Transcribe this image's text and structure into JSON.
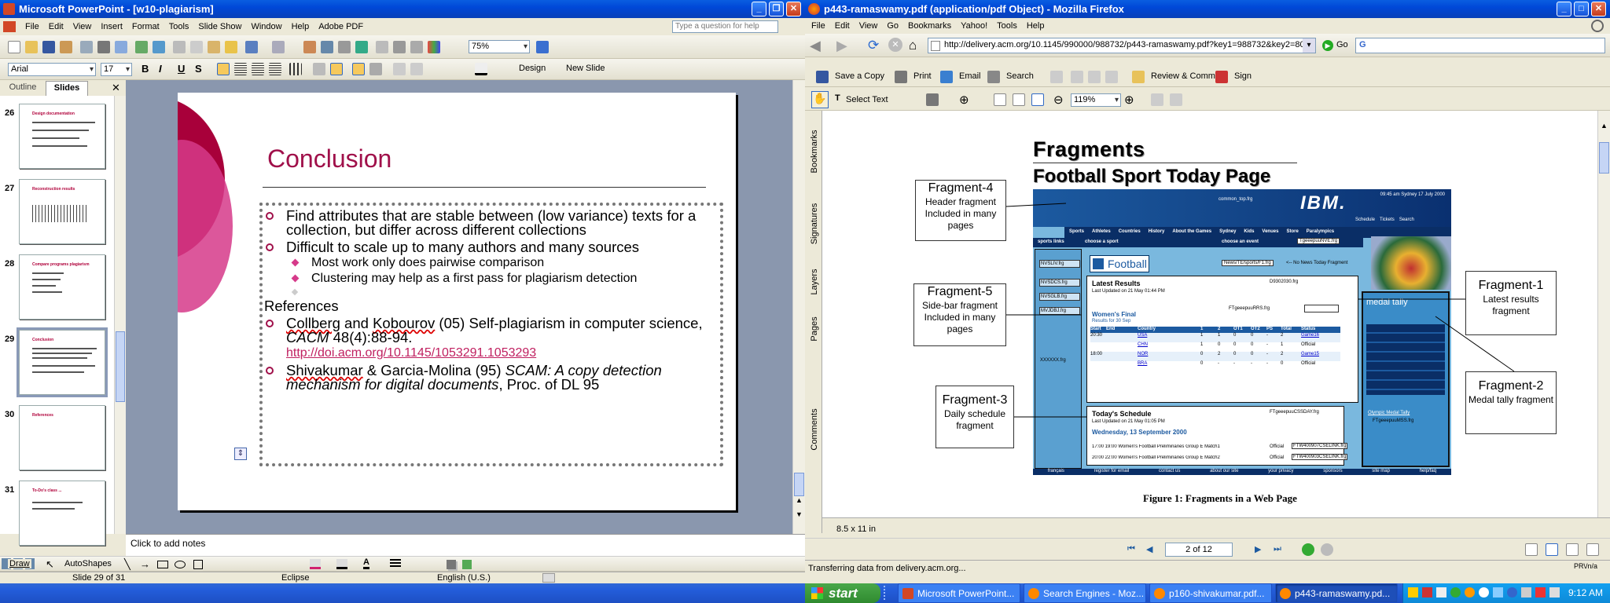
{
  "powerpoint": {
    "title": "Microsoft PowerPoint - [w10-plagiarism]",
    "menu": [
      "File",
      "Edit",
      "View",
      "Insert",
      "Format",
      "Tools",
      "Slide Show",
      "Window",
      "Help",
      "Adobe PDF"
    ],
    "help_placeholder": "Type a question for help",
    "zoom": "75%",
    "font": "Arial",
    "font_size": "17",
    "format_buttons": {
      "bold": "B",
      "italic": "I",
      "underline": "U",
      "shadow": "S"
    },
    "design_label": "Design",
    "new_slide_label": "New Slide",
    "tabs": [
      "Outline",
      "Slides"
    ],
    "thumbs": [
      {
        "num": "26",
        "title": "Design documentation"
      },
      {
        "num": "27",
        "title": "Reconstruction results"
      },
      {
        "num": "28",
        "title": "Compare programs plagiarism"
      },
      {
        "num": "29",
        "title": "Conclusion"
      },
      {
        "num": "30",
        "title": "References"
      },
      {
        "num": "31",
        "title": "To-Do's class ..."
      }
    ],
    "slide": {
      "title": "Conclusion",
      "b1": "Find attributes that are stable between (low variance) texts for a collection, but differ across different collections",
      "b2": "Difficult to scale up to many authors and many sources",
      "s1": "Most work only does pairwise comparison",
      "s2": "Clustering may help as a first pass for plagiarism detection",
      "refs": "References",
      "r1a": "Collberg",
      "r1b": " and ",
      "r1c": "Kobourov",
      "r1d": " (05) Self-plagiarism in computer science, ",
      "r1e": "CACM",
      "r1f": " 48(4):88-94.",
      "r1url": "http://doi.acm.org/10.1145/1053291.1053293",
      "r2a": "Shivakumar",
      "r2b": " & Garcia-Molina (95) ",
      "r2c": "SCAM: A copy detection mechanism for digital documents",
      "r2d": ", Proc. of DL 95"
    },
    "notes": "Click to add notes",
    "draw": "Draw",
    "autoshapes": "AutoShapes",
    "status": {
      "slide": "Slide 29 of 31",
      "theme": "Eclipse",
      "lang": "English (U.S.)"
    }
  },
  "firefox": {
    "title": "p443-ramaswamy.pdf (application/pdf Object) - Mozilla Firefox",
    "menu": [
      "File",
      "Edit",
      "View",
      "Go",
      "Bookmarks",
      "Yahoo!",
      "Tools",
      "Help"
    ],
    "url": "http://delivery.acm.org/10.1145/990000/988732/p443-ramaswamy.pdf?key1=988732&key2=8023998211&coll=Portal&dl=",
    "go": "Go",
    "search_value": "G",
    "acrobat": {
      "save": "Save a Copy",
      "print": "Print",
      "email": "Email",
      "search": "Search",
      "review": "Review & Comment",
      "sign": "Sign",
      "select_text": "Select Text",
      "zoom": "119%"
    },
    "side_tabs": [
      "Bookmarks",
      "Signatures",
      "Layers",
      "Pages",
      "Comments"
    ],
    "page": {
      "h1": "Fragments",
      "h2": "Football Sport Today Page",
      "f4": {
        "t": "Fragment-4",
        "d": "Header fragment Included in many pages"
      },
      "f5": {
        "t": "Fragment-5",
        "d": "Side-bar fragment Included in many pages"
      },
      "f3": {
        "t": "Fragment-3",
        "d": "Daily schedule fragment"
      },
      "f1": {
        "t": "Fragment-1",
        "d": "Latest results fragment"
      },
      "f2": {
        "t": "Fragment-2",
        "d": "Medal tally fragment"
      },
      "caption": "Figure 1: Fragments in a Web Page",
      "shot": {
        "common": "common_top.frg",
        "ibm": "IBM.",
        "time": "09:45 am Sydney 17 July 2000",
        "nav": [
          "Sports",
          "Athletes",
          "Countries",
          "History",
          "About the Games",
          "Sydney",
          "Kids",
          "Venues",
          "Store",
          "Paralympics"
        ],
        "nav2": [
          "Schedule",
          "Tickets",
          "Search"
        ],
        "sports_links": "sports links",
        "choose_sport": "choose a sport",
        "choose_event": "choose an event",
        "nve": "TgeeepuuNVE.frg",
        "football": "Football",
        "news": "News/TE/sports/F1.frg",
        "news2": "<-- No News Today Fragment",
        "latest": "Latest Results",
        "latest_upd": "Last Updated on 21 May 01:44 PM",
        "frg930": "D9302030.frg",
        "rrs": "FTgeeepuuRRS.frg",
        "womens": "Women's Final",
        "results_for": "Results for 30 Sep",
        "cols": [
          "Start",
          "End",
          "Country",
          "1",
          "2",
          "OT1",
          "OT2",
          "PS",
          "Total",
          "Status"
        ],
        "rows": [
          [
            "20:30",
            "USA",
            "1",
            "1",
            "0",
            "0",
            "-",
            "2",
            "Game16"
          ],
          [
            "",
            "CHN",
            "1",
            "0",
            "0",
            "0",
            "-",
            "1",
            "Official"
          ],
          [
            "18:00",
            "NOR",
            "0",
            "2",
            "0",
            "0",
            "-",
            "2",
            "Game15"
          ],
          [
            "",
            "BRA",
            "0",
            "-",
            "-",
            "-",
            "-",
            "0",
            "Official"
          ]
        ],
        "side": [
          "NVSLIV.frg",
          "NVSDCS.frg",
          "NVSGLB.frg",
          "MVJDBJ.frg",
          "XXXXXX.frg"
        ],
        "sched": "Today's Schedule",
        "sched_upd": "Last Updated on 21 May 01:05 PM",
        "csd": "FTgeeepuuCSSDAY.frg",
        "wed": "Wednesday, 13 September 2000",
        "srow1": "17:00 19:00 Women's Football Preliminaries Group E Match1",
        "srow2": "20:00 22:00 Women's Football Preliminaries Group E Match2",
        "srow1s": "Official",
        "srow2s": "Official",
        "ft1": "FTW400907CSELINK.frg",
        "ft2": "FTW400903CSELINK.frg",
        "medal": "medal tally",
        "msd": "FTgeeepuuMSS.frg",
        "olympic": "Olympic Medal Tally",
        "footer": [
          "français",
          "register for email",
          "contact us",
          "about our site",
          "your privacy",
          "sponsors",
          "site map",
          "help/faq"
        ]
      }
    },
    "page_size": "8.5 x 11 in",
    "page_num": "2 of 12",
    "status": "Transferring data from delivery.acm.org...",
    "lang": "PR\\/n/a"
  },
  "taskbar": {
    "start": "start",
    "items": [
      "Microsoft PowerPoint...",
      "Search Engines - Moz...",
      "p160-shivakumar.pdf...",
      "p443-ramaswamy.pd..."
    ],
    "clock": "9:12 AM"
  }
}
